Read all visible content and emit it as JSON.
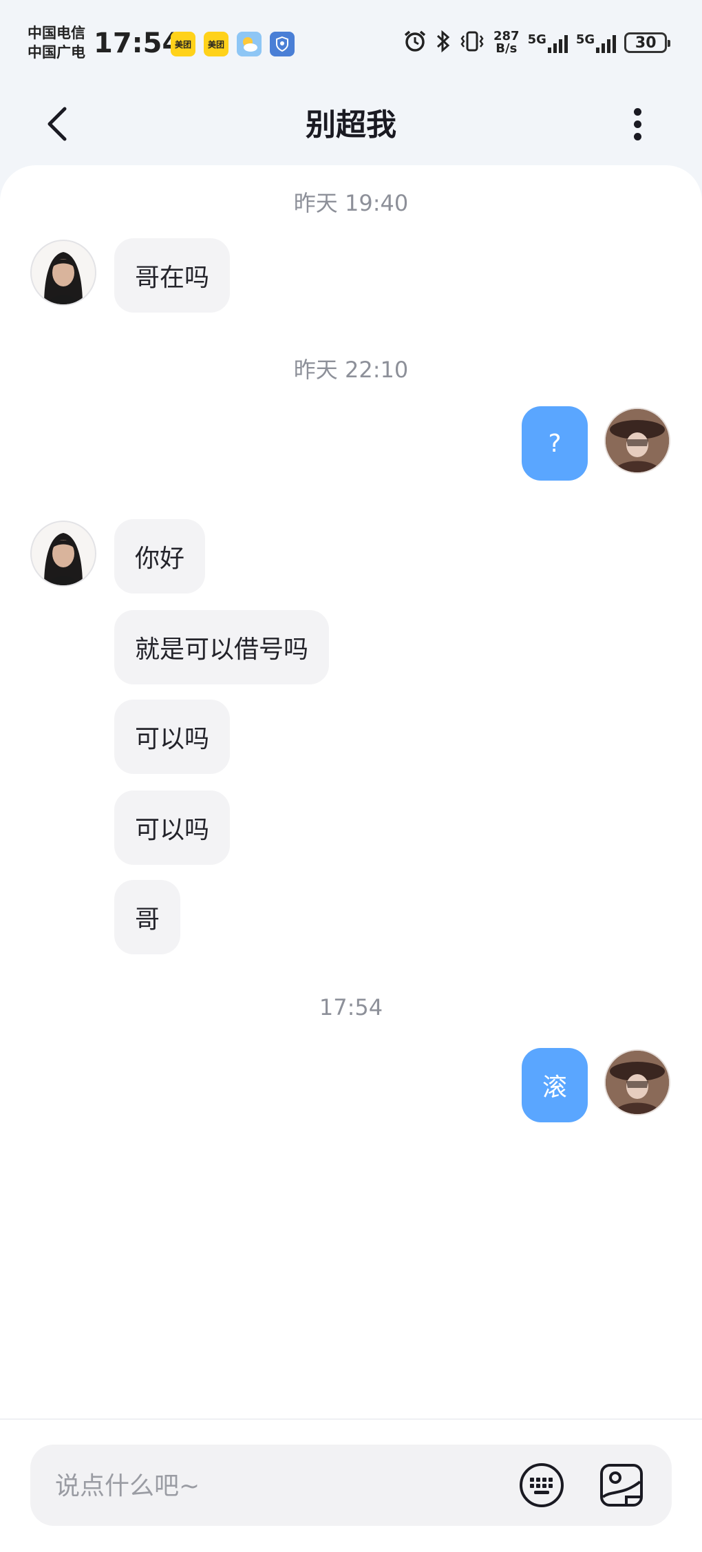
{
  "status_bar": {
    "carrier_1": "中国电信",
    "carrier_2": "中国广电",
    "time": "17:54",
    "notif_icons": [
      "meituan-icon",
      "meituan-icon",
      "weather-icon",
      "security-app-icon"
    ],
    "meituan_label": "美团",
    "net_speed_value": "287",
    "net_speed_unit": "B/s",
    "sim1_network": "5G",
    "sim2_network": "5G",
    "battery": "30"
  },
  "header": {
    "title": "别超我"
  },
  "messages": {
    "ts1": "昨天 19:40",
    "m1": "哥在吗",
    "ts2": "昨天 22:10",
    "m2": "?",
    "m3": "你好",
    "m4": "就是可以借号吗",
    "m5": "可以吗",
    "m6": "可以吗",
    "m7": "哥",
    "ts3": "17:54",
    "m8": "滚"
  },
  "input": {
    "placeholder": "说点什么吧~"
  },
  "colors": {
    "outgoing_bubble": "#5aa6ff",
    "incoming_bubble": "#f3f3f5",
    "page_bg": "#f2f5f9"
  }
}
